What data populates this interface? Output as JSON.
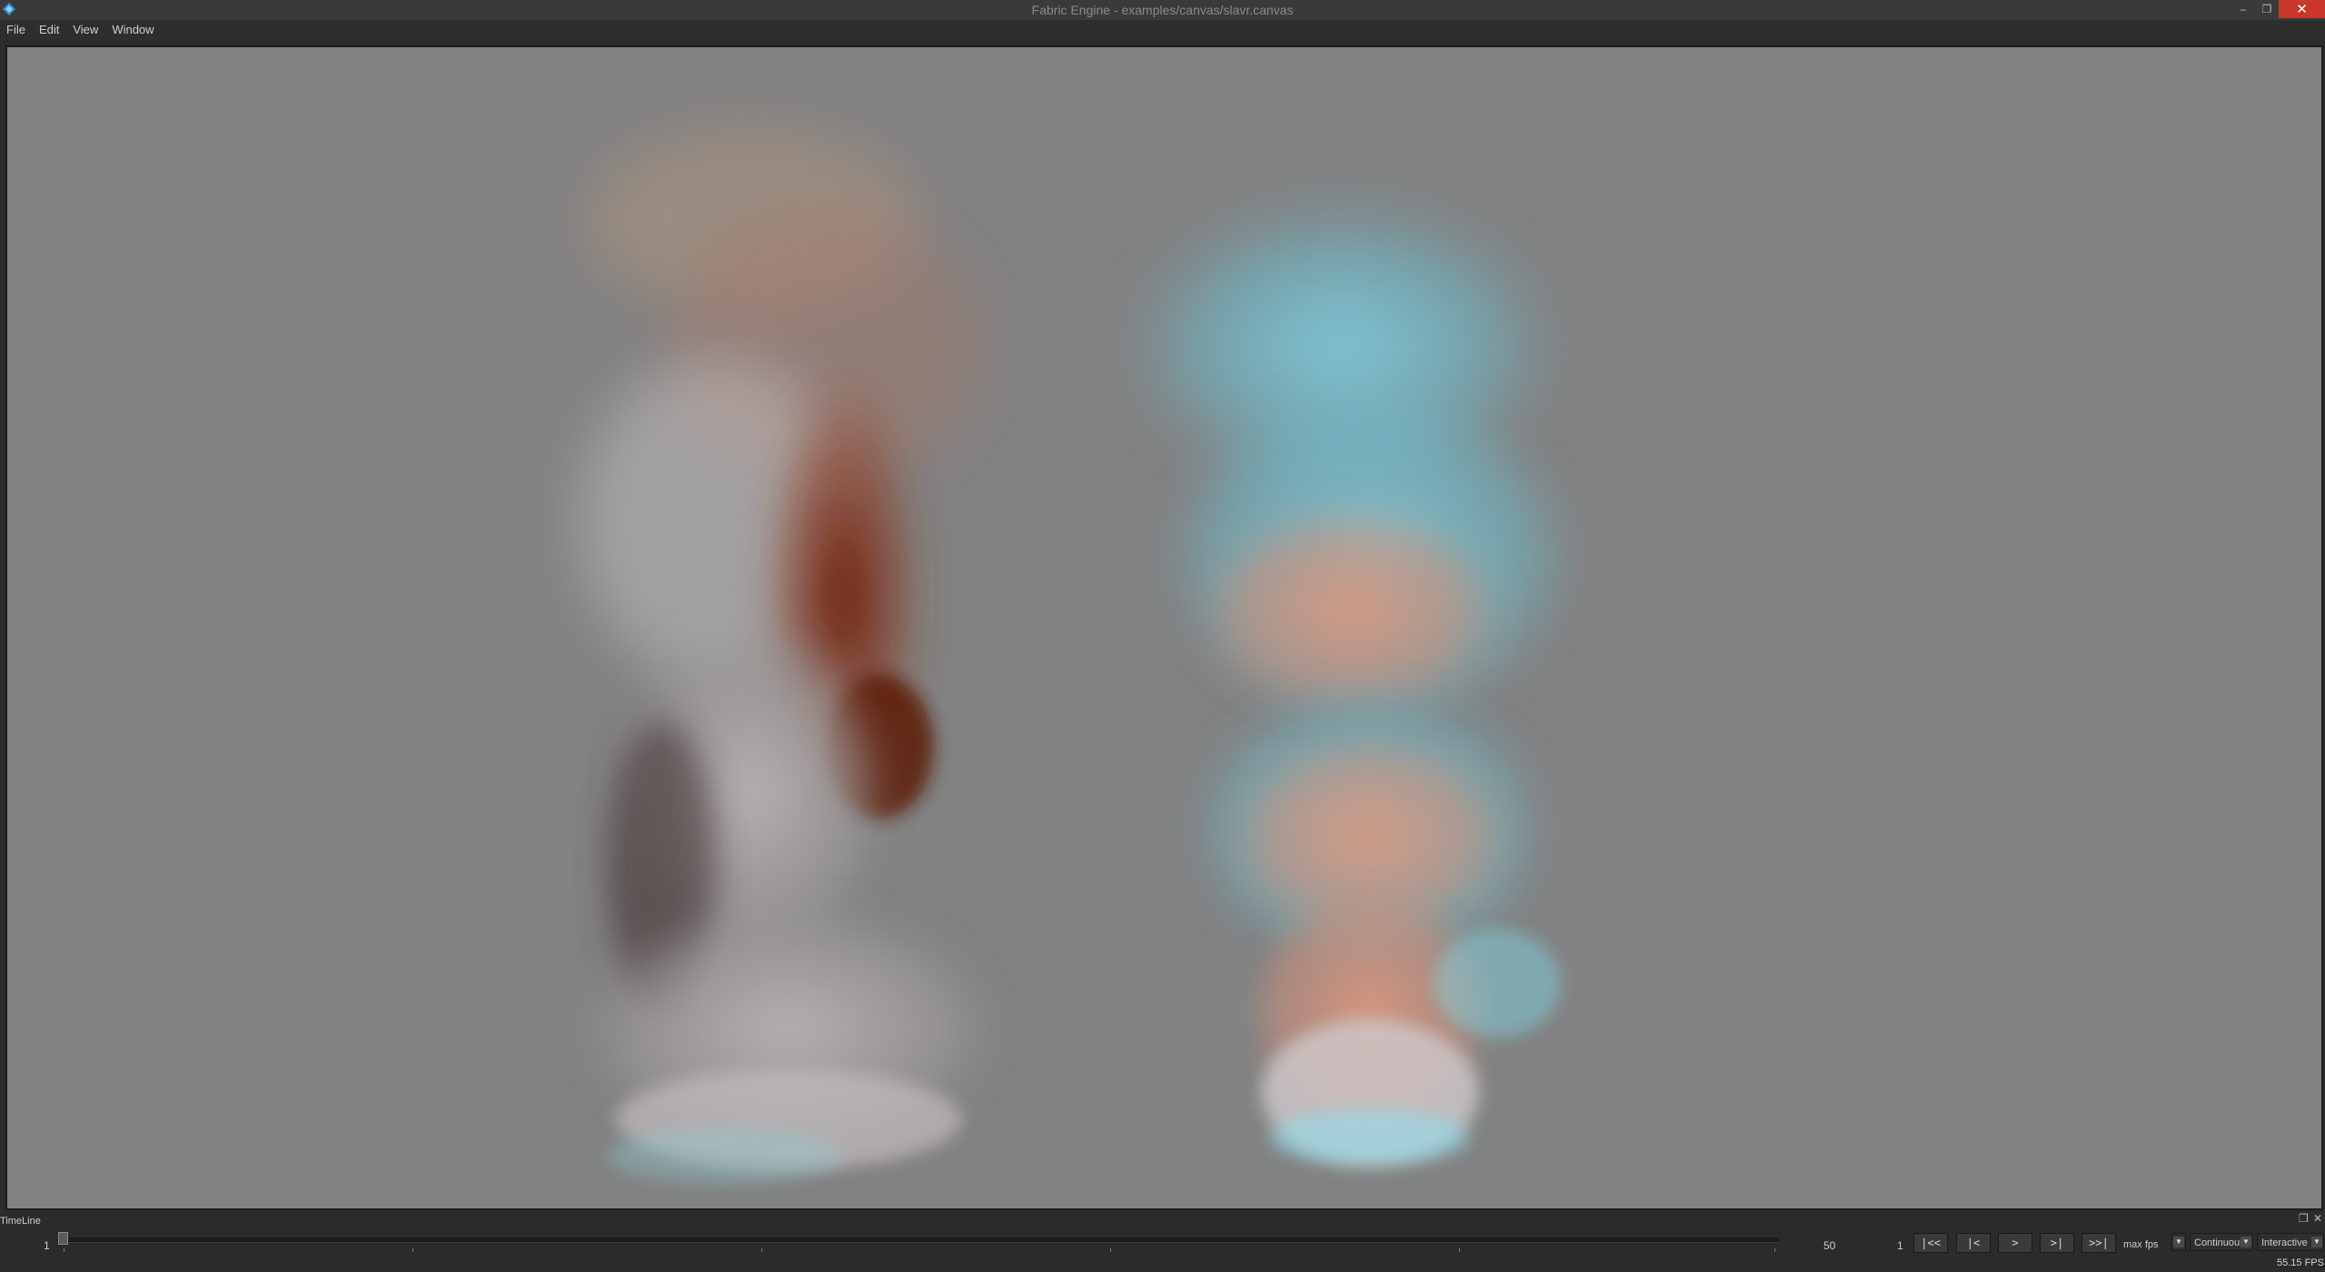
{
  "window": {
    "title": "Fabric Engine - examples/canvas/slavr.canvas",
    "minimize_glyph": "–",
    "maximize_glyph": "❐",
    "close_glyph": "✕",
    "app_icon": "fabric-diamond-icon"
  },
  "menu": {
    "items": [
      "File",
      "Edit",
      "View",
      "Window"
    ]
  },
  "viewport": {
    "background_color": "#828282",
    "content": "volumetric-smoke-render"
  },
  "timeline": {
    "title": "TimeLine",
    "float_glyph": "❐",
    "close_glyph": "✕",
    "start_frame": "1",
    "end_frame": "50",
    "current_frame": "1",
    "playhead_position": 0.0,
    "buttons": {
      "go_start": "|<<",
      "step_back": "|<",
      "play": ">",
      "step_forward": ">|",
      "go_end": ">>|"
    },
    "fps_mode_label": "max fps",
    "loop_mode": "Continuous",
    "sim_mode": "Interactive",
    "dropdown_arrow": "▼",
    "fps_readout": "55.15 FPS"
  }
}
